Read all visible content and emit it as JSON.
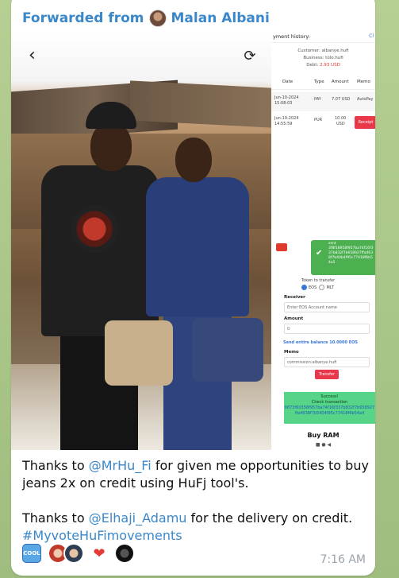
{
  "forward": {
    "prefix": "Forwarded from",
    "name": "Malan Albani"
  },
  "phone": {
    "title": "yment history:",
    "link": "Cl",
    "customer": "Customer: albanye.hufi",
    "business": "Business: tolo.hufi",
    "debt_label": "Debt: ",
    "debt_value": "2.93 USD",
    "headers": [
      "Date",
      "Type",
      "Amount",
      "Memo"
    ],
    "rows": [
      {
        "date1": "Jun-10-2024",
        "date2": "15:08:03",
        "type": "PAY",
        "amount": "7.07 USD",
        "memo": "AutoPay"
      },
      {
        "date1": "Jun-10-2024",
        "date2": "14:55:59",
        "type": "PUR",
        "amount1": "10.00",
        "amount2": "USD",
        "memo": "Receipt"
      }
    ],
    "toast_title": "sent",
    "toast_hash": "3f8f18958f957ba74f16f337b832f7b658927ffa4638f7b40b4f95c77418f6b54a5",
    "token_label": "Token to transfer",
    "token_options": [
      "EOS",
      "MLT"
    ],
    "receiver_label": "Receiver",
    "receiver_placeholder": "Enter EOS Account name",
    "amount_label": "Amount",
    "amount_value": "0",
    "send_entire": "Send entire balance 10.0000 EOS",
    "memo_label": "Memo",
    "memo_value": "commission:albanye.hufi",
    "transfer_btn": "Transfer",
    "success_title": "Success!",
    "check_tx": "Check transaction",
    "tx_hash": "9873f60358f957ba74f16f337b832f7b658927ffa4638f7b5404f95c77418f6b54a4",
    "buy_ram": "Buy RAM",
    "nav": "■   ●   ◀"
  },
  "message": {
    "line1_pre": "Thanks to ",
    "mention1": "@MrHu_Fi",
    "line1_post": " for given me opportunities to buy",
    "line2": "jeans 2x on credit using HuFj tool's.",
    "line3_pre": "Thanks to ",
    "mention2": "@Elhaji_Adamu",
    "line3_post": " for the delivery on credit.",
    "hashtag": "#MyvoteHuFimovements"
  },
  "reactions": {
    "cool_label": "COOL"
  },
  "time": "7:16 AM",
  "colors": {
    "accent": "#3a87c9",
    "bubble": "#ffffff",
    "bg": "#a9c48a"
  }
}
